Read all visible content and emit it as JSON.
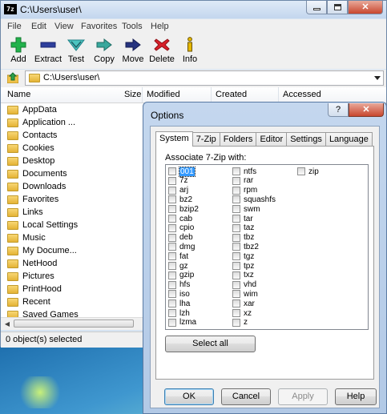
{
  "main_window": {
    "icon_text": "7z",
    "title": "C:\\Users\\user\\",
    "menu": [
      "File",
      "Edit",
      "View",
      "Favorites",
      "Tools",
      "Help"
    ],
    "toolbar": [
      {
        "label": "Add",
        "icon": "add-icon"
      },
      {
        "label": "Extract",
        "icon": "extract-icon"
      },
      {
        "label": "Test",
        "icon": "test-icon"
      },
      {
        "label": "Copy",
        "icon": "copy-icon"
      },
      {
        "label": "Move",
        "icon": "move-icon"
      },
      {
        "label": "Delete",
        "icon": "delete-icon"
      },
      {
        "label": "Info",
        "icon": "info-icon"
      }
    ],
    "address": "C:\\Users\\user\\",
    "columns": [
      "Name",
      "Size",
      "Modified",
      "Created",
      "Accessed"
    ],
    "files": [
      "AppData",
      "Application ...",
      "Contacts",
      "Cookies",
      "Desktop",
      "Documents",
      "Downloads",
      "Favorites",
      "Links",
      "Local Settings",
      "Music",
      "My Docume...",
      "NetHood",
      "Pictures",
      "PrintHood",
      "Recent",
      "Saved Games"
    ],
    "status": "0 object(s) selected"
  },
  "dialog": {
    "title": "Options",
    "help_button": "?",
    "tabs": [
      "System",
      "7-Zip",
      "Folders",
      "Editor",
      "Settings",
      "Language"
    ],
    "active_tab": "System",
    "associate_label": "Associate 7-Zip with:",
    "extensions": {
      "col1": [
        "001",
        "7z",
        "arj",
        "bz2",
        "bzip2",
        "cab",
        "cpio",
        "deb",
        "dmg",
        "fat",
        "gz",
        "gzip",
        "hfs",
        "iso",
        "lha",
        "lzh",
        "lzma"
      ],
      "col2": [
        "ntfs",
        "rar",
        "rpm",
        "squashfs",
        "swm",
        "tar",
        "taz",
        "tbz",
        "tbz2",
        "tgz",
        "tpz",
        "txz",
        "vhd",
        "wim",
        "xar",
        "xz",
        "z"
      ],
      "col3": [
        "zip"
      ]
    },
    "select_all": "Select all",
    "buttons": {
      "ok": "OK",
      "cancel": "Cancel",
      "apply": "Apply",
      "help": "Help"
    }
  },
  "colors": {
    "accent": "#3399ff",
    "dialog_frame": "#b2c9e6",
    "close_red": "#c8462e"
  }
}
